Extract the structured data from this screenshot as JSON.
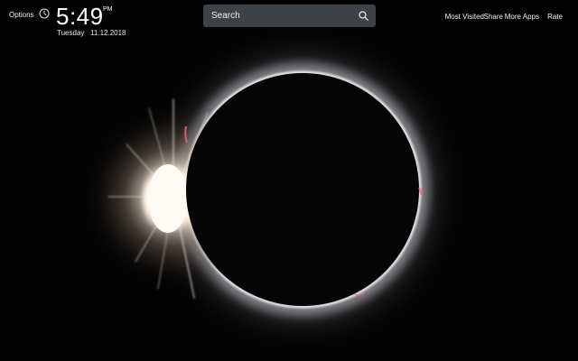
{
  "header": {
    "options_label": "Options",
    "clock_icon": "clock-icon",
    "time": "5:49",
    "ampm": "PM",
    "weekday": "Tuesday",
    "date": "11.12.2018"
  },
  "search": {
    "placeholder": "Search",
    "icon": "search-icon"
  },
  "nav": {
    "most_visited": "Most Visited",
    "share": "Share",
    "more_apps": "More Apps",
    "rate": "Rate"
  },
  "background": {
    "subject": "total solar eclipse with diamond ring",
    "colors": {
      "sky": "#020202",
      "moon": "#050505",
      "corona": "#e8e6ea",
      "diamond": "#fff4ea",
      "prominence": "#ff5a7a",
      "search_bg": "#3d4246"
    }
  }
}
